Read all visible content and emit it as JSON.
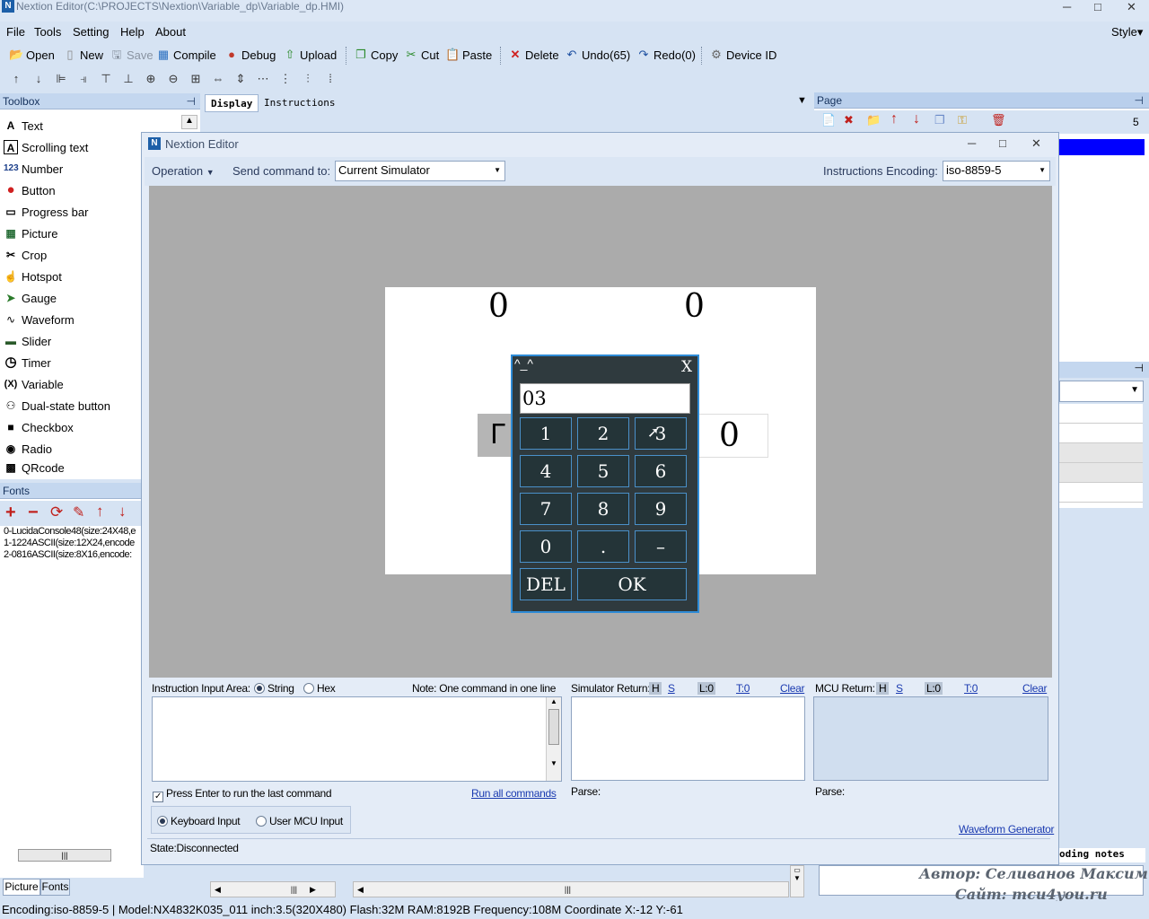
{
  "app": {
    "title": "Nextion Editor(C:\\PROJECTS\\Nextion\\Variable_dp\\Variable_dp.HMI)",
    "logo": "N"
  },
  "window_controls": {
    "minimize": "─",
    "maximize": "□",
    "close": "✕"
  },
  "menu": {
    "items": [
      "File",
      "Tools",
      "Setting",
      "Help",
      "About"
    ],
    "style": "Style▾"
  },
  "toolbar": {
    "open": "Open",
    "new": "New",
    "save": "Save",
    "compile": "Compile",
    "debug": "Debug",
    "upload": "Upload",
    "copy": "Copy",
    "cut": "Cut",
    "paste": "Paste",
    "delete": "Delete",
    "undo": "Undo(65)",
    "redo": "Redo(0)",
    "device_id": "Device  ID"
  },
  "toolbox": {
    "title": "Toolbox",
    "items": [
      {
        "label": "Text",
        "icon": "A"
      },
      {
        "label": "Scrolling text",
        "icon": "A"
      },
      {
        "label": "Number",
        "icon": "123"
      },
      {
        "label": "Button",
        "icon": "●"
      },
      {
        "label": "Progress bar",
        "icon": "▭"
      },
      {
        "label": "Picture",
        "icon": "▦"
      },
      {
        "label": "Crop",
        "icon": "✂"
      },
      {
        "label": "Hotspot",
        "icon": "☝"
      },
      {
        "label": "Gauge",
        "icon": "➤"
      },
      {
        "label": "Waveform",
        "icon": "∿"
      },
      {
        "label": "Slider",
        "icon": "▬"
      },
      {
        "label": "Timer",
        "icon": "◷"
      },
      {
        "label": "Variable",
        "icon": "(X)"
      },
      {
        "label": "Dual-state button",
        "icon": "⚇"
      },
      {
        "label": "Checkbox",
        "icon": "■"
      },
      {
        "label": "Radio",
        "icon": "◉"
      },
      {
        "label": "QRcode",
        "icon": "▩"
      }
    ]
  },
  "fonts": {
    "title": "Fonts",
    "items": [
      "0-LucidaConsole48(size:24X48,e",
      "1-1224ASCII(size:12X24,encode",
      "2-0816ASCII(size:8X16,encode:"
    ]
  },
  "bottom_tabs": {
    "picture": "Picture",
    "fonts": "Fonts"
  },
  "center_tabs": {
    "display": "Display",
    "instructions": "Instructions"
  },
  "page_panel": {
    "title": "Page",
    "count": "5"
  },
  "right_panel": {
    "notes": "oding notes"
  },
  "simulator": {
    "title": "Nextion Editor",
    "operation": "Operation",
    "send_label": "Send command to:",
    "send_value": "Current Simulator",
    "encoding_label": "Instructions Encoding:",
    "encoding_value": "iso-8859-5",
    "screen": {
      "top_text": "0",
      "top_right": "0",
      "btn_text": "Г",
      "num_value": "0"
    },
    "keyboard": {
      "title": "^_^",
      "close": "X",
      "input": "03",
      "keys": [
        "1",
        "2",
        "3",
        "4",
        "5",
        "6",
        "7",
        "8",
        "9",
        "0",
        ".",
        "–"
      ],
      "del": "DEL",
      "ok": "OK"
    },
    "instr_area_label": "Instruction Input Area:",
    "radio_string": "String",
    "radio_hex": "Hex",
    "note": "Note: One command in one line",
    "sim_return": "Simulator Return:",
    "mcu_return": "MCU Return:",
    "ret_h": "H",
    "ret_s": "S",
    "ret_l": "L:0",
    "ret_t": "T:0",
    "clear": "Clear",
    "press_enter": "Press Enter to run the last command",
    "run_all": "Run all commands",
    "parse": "Parse:",
    "keyboard_input": "Keyboard Input",
    "user_mcu_input": "User MCU Input",
    "waveform_gen": "Waveform Generator",
    "state": "State:Disconnected"
  },
  "status_bar": "Encoding:iso-8859-5 | Model:NX4832K035_011  inch:3.5(320X480) Flash:32M RAM:8192B Frequency:108M    Coordinate X:-12  Y:-61",
  "watermark": {
    "line1": "Автор: Селиванов Максим",
    "line2": "Сайт: mcu4you.ru"
  },
  "colors": {
    "accent": "#2e8bd6",
    "panel": "#d6e3f3",
    "keyboard_bg": "#2f3a3e",
    "selection": "#0000ff"
  }
}
